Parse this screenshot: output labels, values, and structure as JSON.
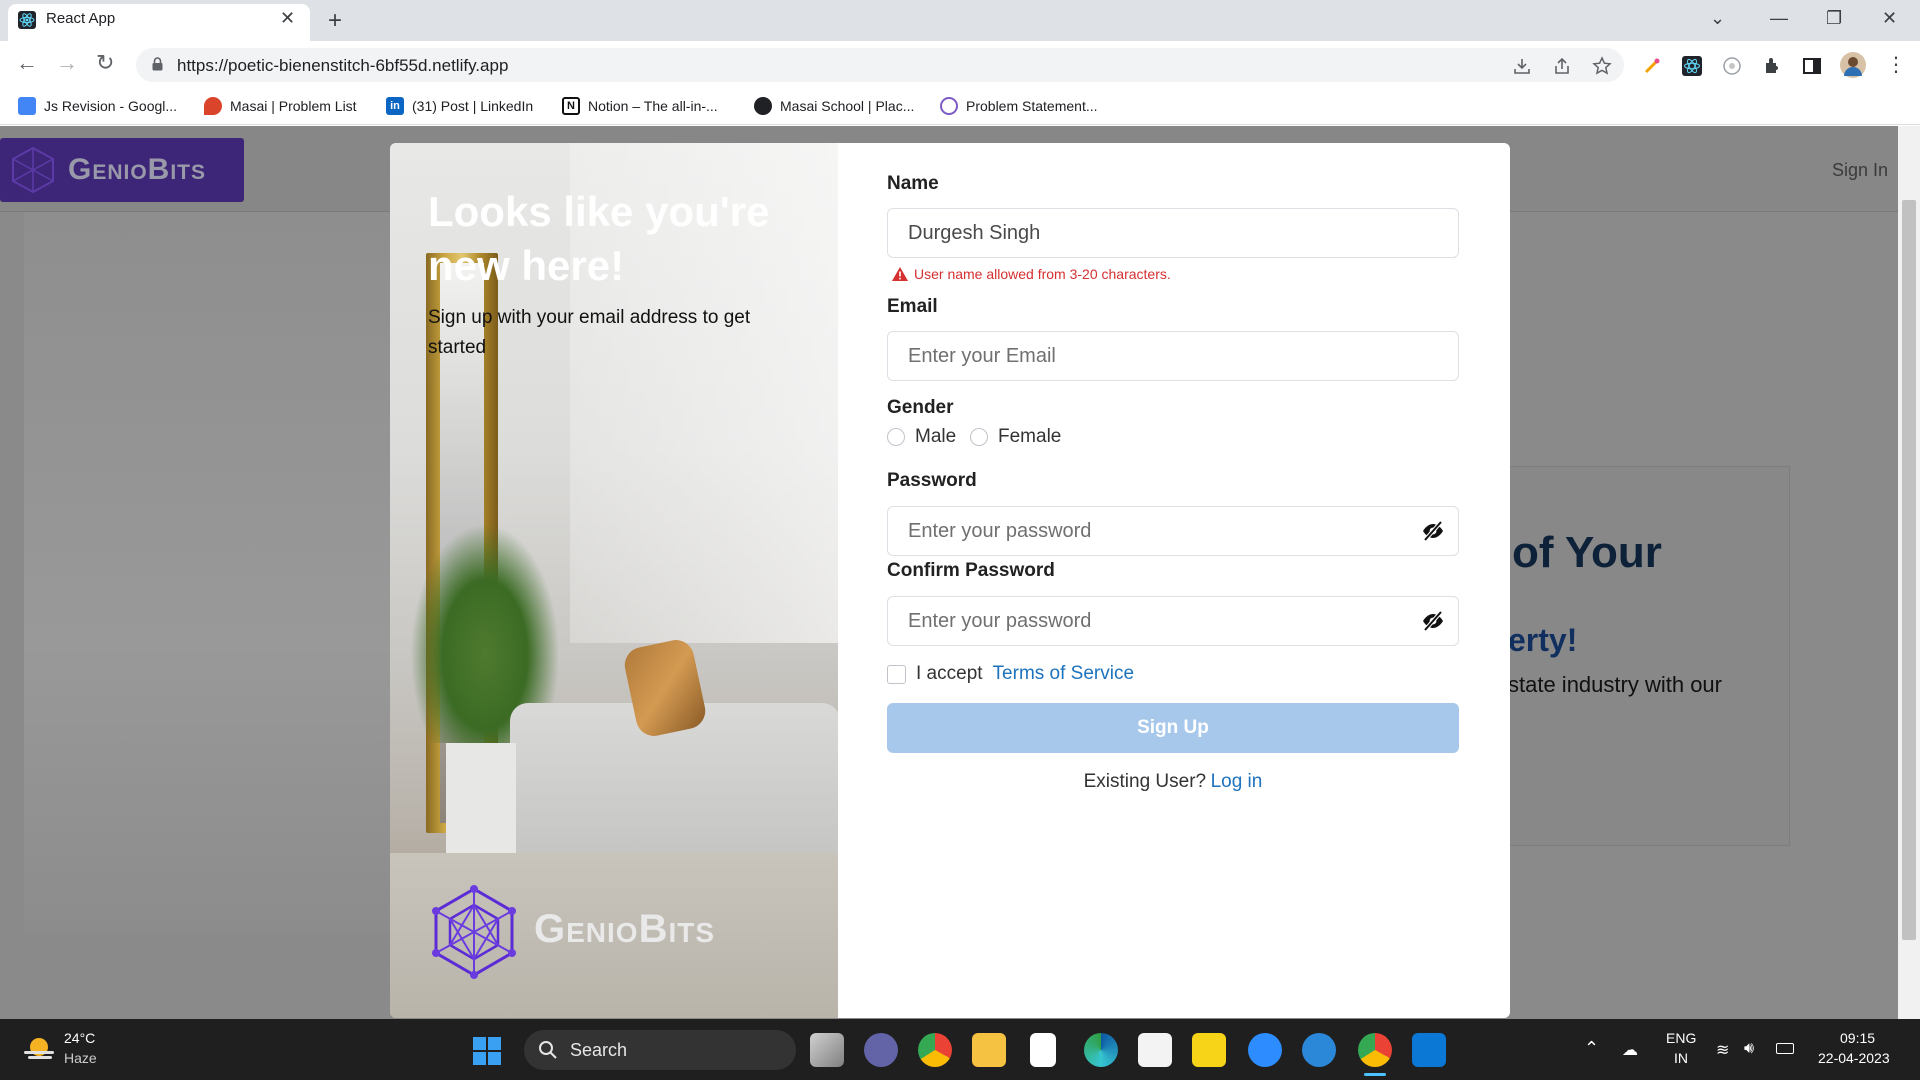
{
  "browser": {
    "tab_title": "React App",
    "url": "https://poetic-bienenstitch-6bf55d.netlify.app",
    "bookmarks": [
      {
        "label": "Js Revision - Googl...",
        "icon": "google-docs-icon",
        "color": "#4285f4"
      },
      {
        "label": "Masai | Problem List",
        "icon": "masai-icon",
        "color": "#d9442b"
      },
      {
        "label": "(31) Post | LinkedIn",
        "icon": "linkedin-icon",
        "color": "#0a66c2"
      },
      {
        "label": "Notion – The all-in-...",
        "icon": "notion-icon",
        "color": "#111111"
      },
      {
        "label": "Masai School | Plac...",
        "icon": "globe-icon",
        "color": "#202124"
      },
      {
        "label": "Problem Statement...",
        "icon": "react-icon",
        "color": "#7c5cc4"
      }
    ]
  },
  "background_page": {
    "logo_text": "GenioBits",
    "signin_label": "Sign In",
    "hero_heading_fragment": "of Your",
    "hero_sub_fragment": "erty!",
    "hero_text_fragment": "state industry with our"
  },
  "modal": {
    "left": {
      "title": "Looks like you're new here!",
      "subtitle": "Sign up with your email address to get started",
      "logo_text": "GenioBits"
    },
    "form": {
      "name_label": "Name",
      "name_value": "Durgesh Singh",
      "name_error": "User name allowed from 3-20 characters.",
      "email_label": "Email",
      "email_placeholder": "Enter your Email",
      "gender_label": "Gender",
      "gender_options": [
        "Male",
        "Female"
      ],
      "password_label": "Password",
      "password_placeholder": "Enter your password",
      "confirm_label": "Confirm Password",
      "confirm_placeholder": "Enter your password",
      "accept_text": "I accept",
      "terms_link": "Terms of Service",
      "submit_label": "Sign Up",
      "existing_text": "Existing User?",
      "login_link": "Log in"
    },
    "colors": {
      "accent": "#1e73be",
      "button_disabled": "#a8c8eb",
      "error": "#d63031",
      "brand_purple": "#5b2bd6"
    }
  },
  "taskbar": {
    "weather_temp": "24°C",
    "weather_desc": "Haze",
    "search_label": "Search",
    "lang_top": "ENG",
    "lang_bottom": "IN",
    "time": "09:15",
    "date": "22-04-2023"
  }
}
